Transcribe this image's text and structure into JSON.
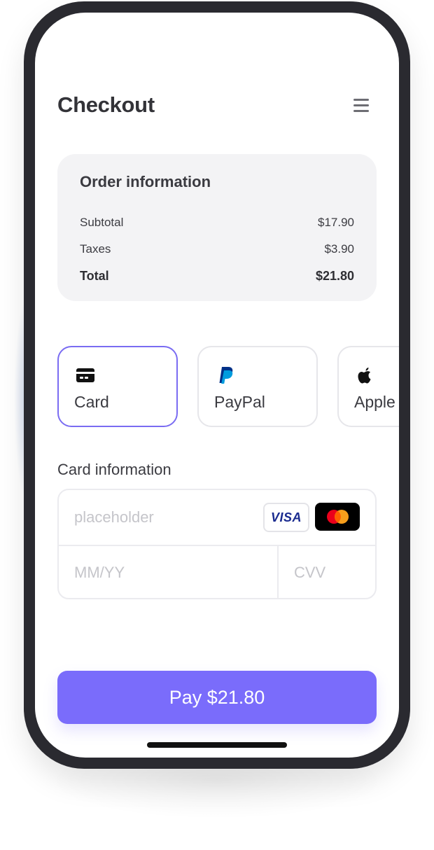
{
  "header": {
    "title": "Checkout",
    "menu_icon": "hamburger-menu-icon"
  },
  "order": {
    "title": "Order information",
    "rows": [
      {
        "label": "Subtotal",
        "value": "$17.90"
      },
      {
        "label": "Taxes",
        "value": "$3.90"
      },
      {
        "label": "Total",
        "value": "$21.80"
      }
    ]
  },
  "payment_methods": [
    {
      "label": "Card",
      "icon": "credit-card-icon",
      "selected": true
    },
    {
      "label": "PayPal",
      "icon": "paypal-icon",
      "selected": false
    },
    {
      "label": "Apple",
      "icon": "apple-icon",
      "selected": false
    }
  ],
  "card_info": {
    "label": "Card information",
    "number_placeholder": "placeholder",
    "expiry_placeholder": "MM/YY",
    "cvv_placeholder": "CVV",
    "brands": [
      "VISA",
      "mastercard-icon"
    ]
  },
  "pay_button": {
    "label": "Pay $21.80"
  },
  "colors": {
    "accent": "#7a6cfb",
    "selected_border": "#7a6cf2",
    "phone_frame": "#2a2a30",
    "visa_blue": "#1a2b8f",
    "mastercard_red": "#eb001b",
    "mastercard_orange": "#f79e1b",
    "paypal_dark": "#003087",
    "paypal_light": "#009cde"
  }
}
